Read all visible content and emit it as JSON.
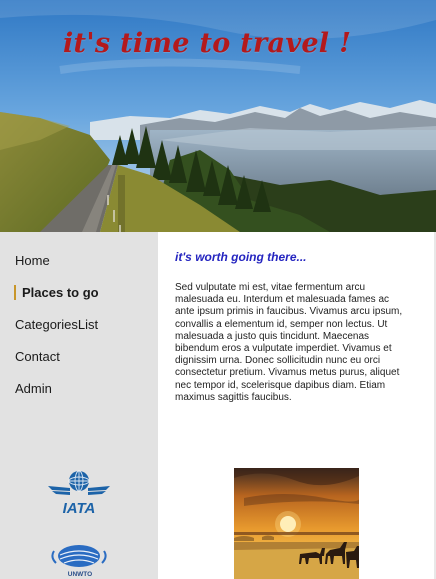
{
  "header": {
    "title": "it's time to travel !"
  },
  "nav": {
    "items": [
      {
        "label": "Home"
      },
      {
        "label": "Places to go"
      },
      {
        "label": "CategoriesList"
      },
      {
        "label": "Contact"
      },
      {
        "label": "Admin"
      }
    ],
    "active_index": 1
  },
  "sidebar": {
    "logos": [
      {
        "name": "IATA",
        "text": "IATA"
      },
      {
        "name": "UNWTO",
        "text": "UNWTO"
      }
    ]
  },
  "main": {
    "heading": "it's worth going there...",
    "body": "Sed vulputate mi est, vitae fermentum arcu malesuada eu. Interdum et malesuada fames ac ante ipsum primis in faucibus. Vivamus arcu ipsum, convallis a elementum id, semper non lectus. Ut malesuada a justo quis tincidunt. Maecenas bibendum eros a vulputate imperdiet. Vivamus et dignissim urna. Donec sollicitudin nunc eu orci consectetur pretium. Vivamus metus purus, aliquet nec tempor id, scelerisque dapibus diam. Etiam maximus sagittis faucibus."
  },
  "colors": {
    "title_red": "#b3191c",
    "heading_blue": "#2525c0",
    "sidebar_bg": "#e2e2e2",
    "active_marker": "#c8962a"
  }
}
